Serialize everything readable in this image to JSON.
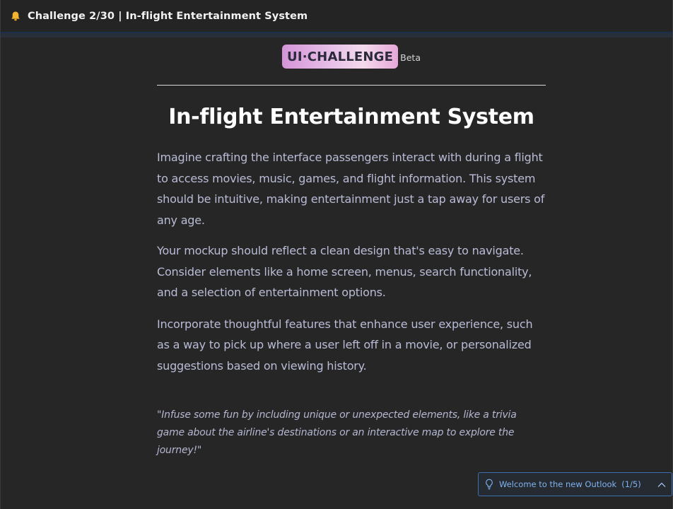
{
  "window": {
    "title": "Challenge 2/30 | In-flight Entertainment System",
    "title_icon": "bell-icon"
  },
  "logo": {
    "text": "UI·CHALLENGE",
    "badge": "Beta"
  },
  "article": {
    "title": "In-flight Entertainment System",
    "paragraphs": [
      "Imagine crafting the interface passengers interact with during a flight to access movies, music, games, and flight information. This system should be intuitive, making entertainment just a tap away for users of any age.",
      "Your mockup should reflect a clean design that's easy to navigate. Consider elements like a home screen, menus, search functionality, and a selection of entertainment options.",
      "Incorporate thoughtful features that enhance user experience, such as a way to pick up where a user left off in a movie, or personalized suggestions based on viewing history."
    ],
    "quote": "\"Infuse some fun by including unique or unexpected elements, like a trivia game about the airline's destinations or an interactive map to explore the journey!\""
  },
  "toast": {
    "icon": "lightbulb-icon",
    "text": "Welcome to the new Outlook",
    "count": "(1/5)",
    "toggle_icon": "chevron-up-icon"
  },
  "colors": {
    "background": "#262626",
    "text_body": "#b9bcd6",
    "title": "#ffffff",
    "accent": "#7fb2f0",
    "logo_gradient_start": "#d494d8",
    "logo_gradient_end": "#e6a7d9"
  }
}
